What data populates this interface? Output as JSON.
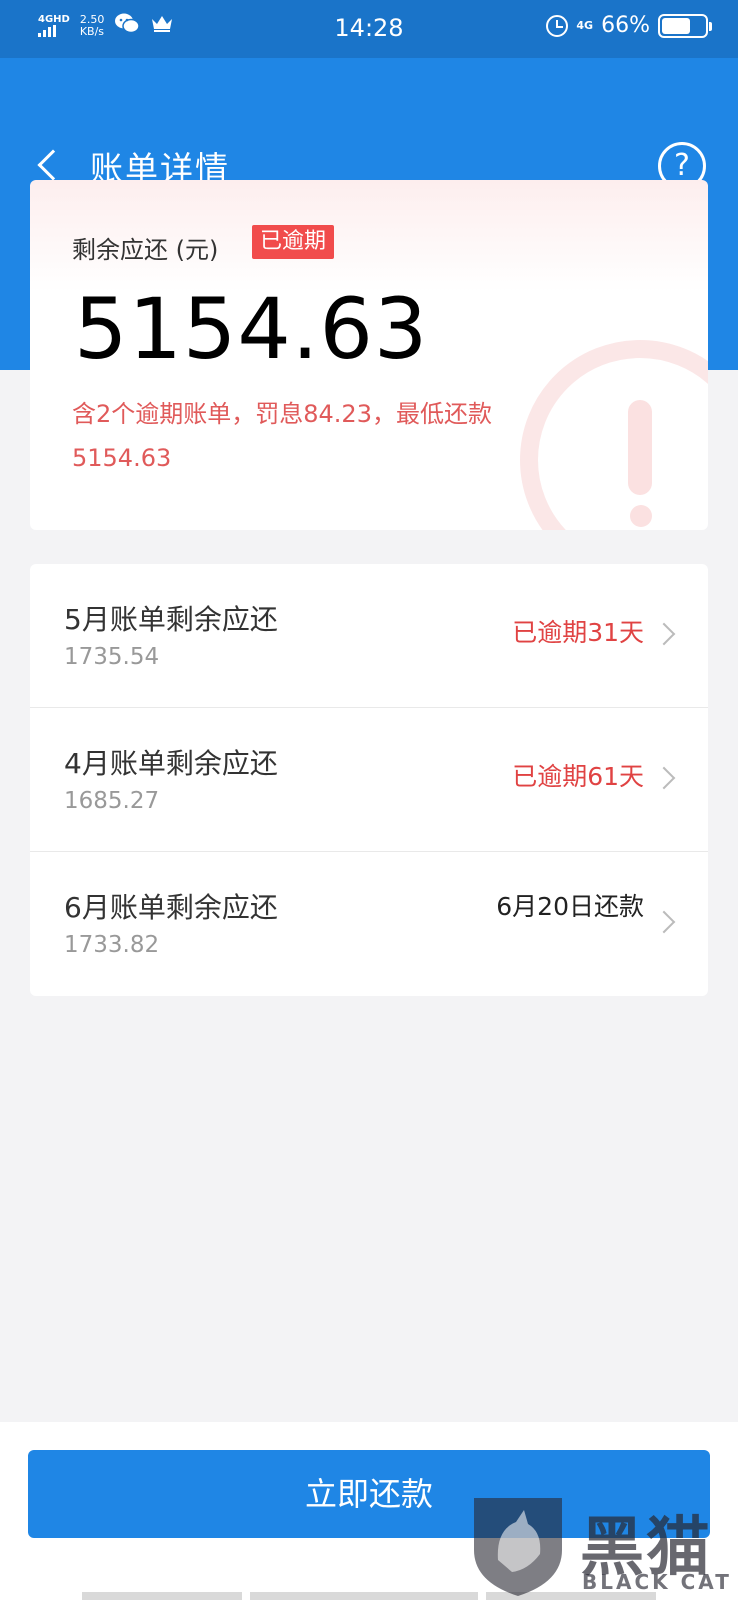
{
  "status_bar": {
    "network": "4GHD",
    "speed_value": "2.50",
    "speed_unit": "KB/s",
    "time": "14:28",
    "network_right": "4G",
    "battery_percent": "66%",
    "battery_level": 0.66
  },
  "header": {
    "title": "账单详情",
    "help_symbol": "?"
  },
  "summary": {
    "label": "剩余应还 (元)",
    "badge": "已逾期",
    "amount": "5154.63",
    "note": "含2个逾期账单，罚息84.23，最低还款5154.63"
  },
  "bills": [
    {
      "title": "5月账单剩余应还",
      "amount": "1735.54",
      "status": "已逾期31天",
      "status_type": "overdue"
    },
    {
      "title": "4月账单剩余应还",
      "amount": "1685.27",
      "status": "已逾期61天",
      "status_type": "overdue"
    },
    {
      "title": "6月账单剩余应还",
      "amount": "1733.82",
      "status": "6月20日还款",
      "status_type": "due"
    }
  ],
  "pay_button": "立即还款",
  "watermark": {
    "cn": "黑猫",
    "en": "BLACK CAT"
  },
  "colors": {
    "header_blue": "#1f86e5",
    "statusbar_blue": "#1a74c9",
    "overdue_red": "#e04343",
    "badge_red": "#f14c4c"
  }
}
